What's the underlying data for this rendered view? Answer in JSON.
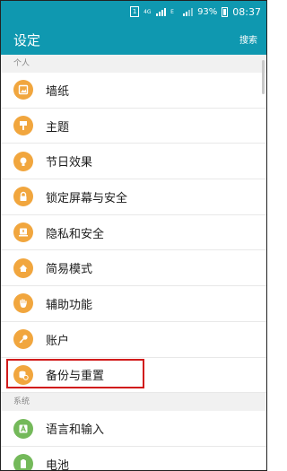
{
  "status": {
    "sim_badge": "1",
    "net": "4G",
    "net2": "E",
    "battery_pct": "93%",
    "time": "08:37"
  },
  "appbar": {
    "title": "设定",
    "search_label": "搜索"
  },
  "sections": [
    {
      "header": "个人",
      "items": [
        {
          "label": "墙纸",
          "icon": "wallpaper-icon"
        },
        {
          "label": "主题",
          "icon": "theme-brush-icon"
        },
        {
          "label": "节日效果",
          "icon": "festival-lightbulb-icon"
        },
        {
          "label": "锁定屏幕与安全",
          "icon": "lock-icon"
        },
        {
          "label": "隐私和安全",
          "icon": "privacy-icon"
        },
        {
          "label": "简易模式",
          "icon": "easy-mode-home-icon"
        },
        {
          "label": "辅助功能",
          "icon": "accessibility-hand-icon"
        },
        {
          "label": "账户",
          "icon": "key-icon"
        },
        {
          "label": "备份与重置",
          "icon": "backup-reset-icon"
        }
      ]
    },
    {
      "header": "系统",
      "items": [
        {
          "label": "语言和输入",
          "icon": "language-a-icon"
        },
        {
          "label": "电池",
          "icon": "battery-icon"
        }
      ]
    }
  ],
  "colors": {
    "accent": "#0f98b0",
    "icon_orange": "#f1a63e",
    "icon_green": "#74b95a",
    "highlight": "#d11a1a"
  }
}
